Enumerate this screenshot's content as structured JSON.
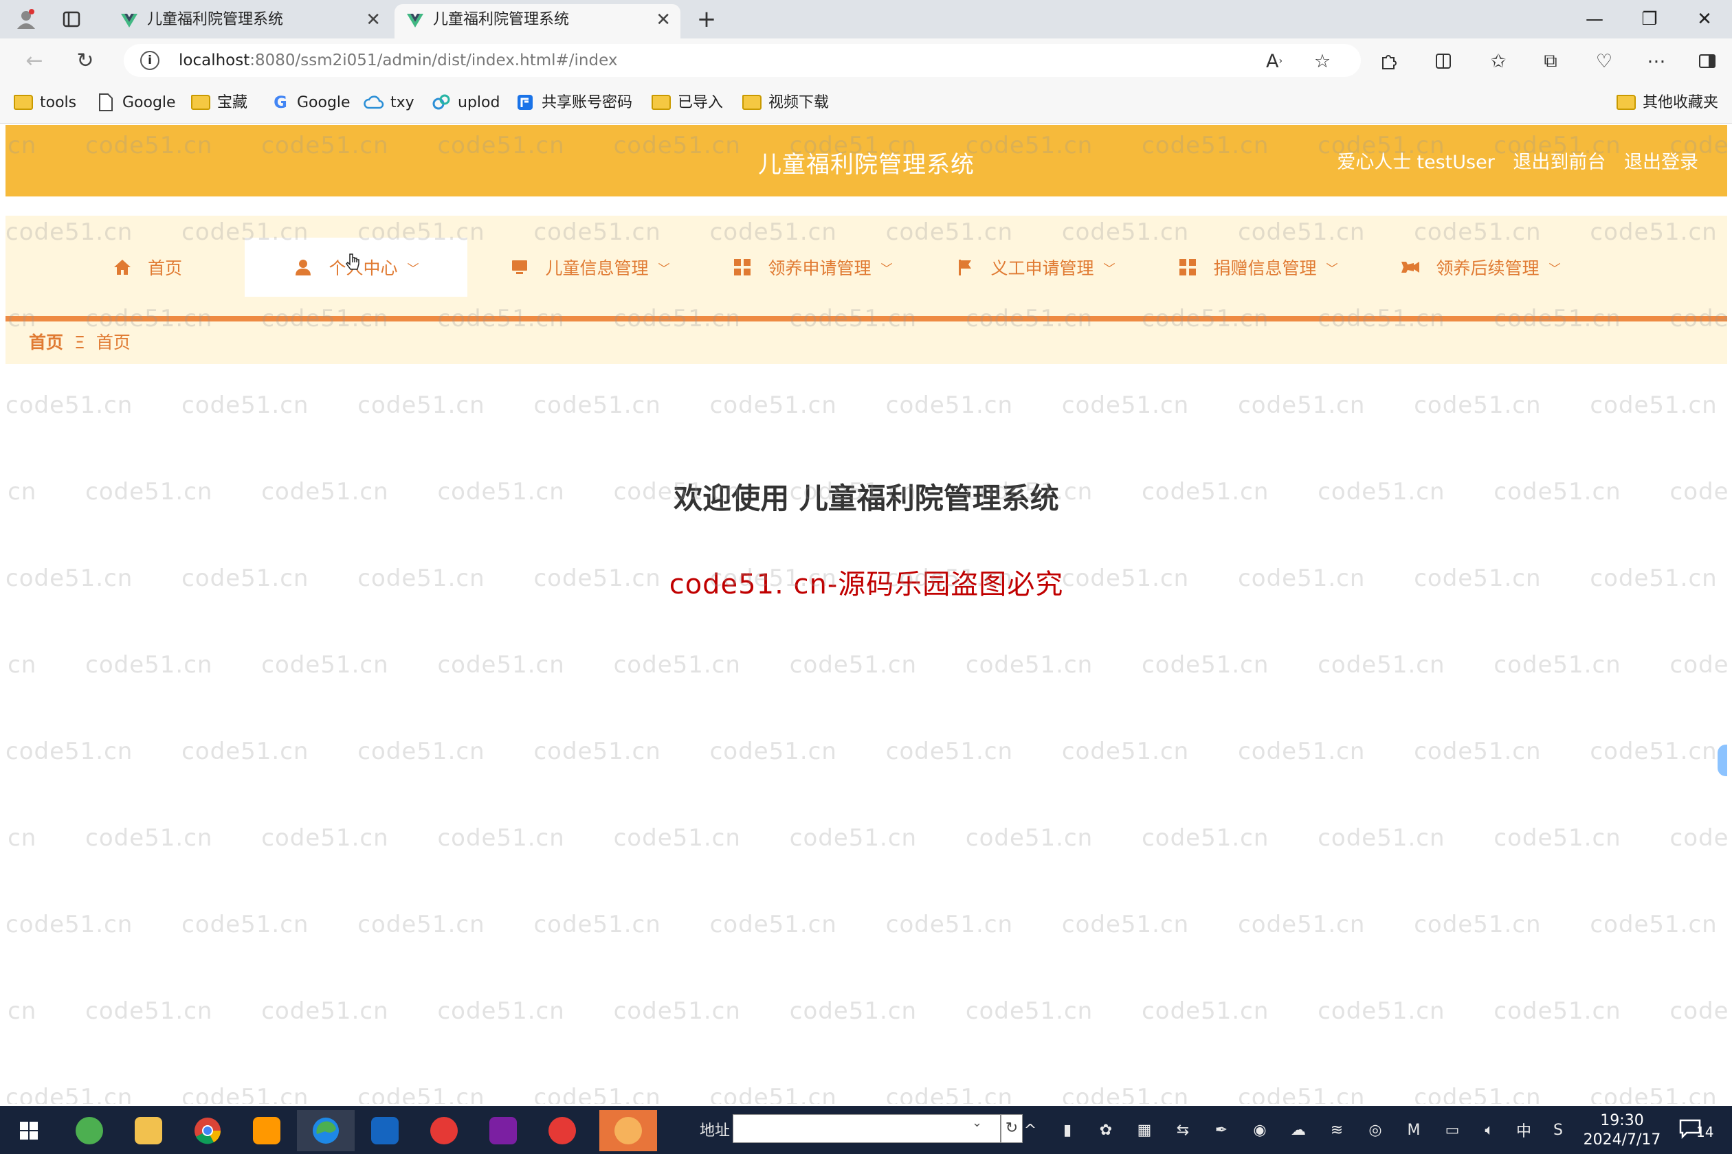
{
  "browser": {
    "tabs": [
      {
        "title": "儿童福利院管理系统",
        "active": false
      },
      {
        "title": "儿童福利院管理系统",
        "active": true
      }
    ],
    "new_tab_icon": "plus-icon",
    "url_host": "localhost",
    "url_rest": ":8080/ssm2i051/admin/dist/index.html#/index",
    "bookmarks": [
      {
        "label": "tools",
        "icon": "folder-icon"
      },
      {
        "label": "Google",
        "icon": "page-icon"
      },
      {
        "label": "宝藏",
        "icon": "folder-icon"
      },
      {
        "label": "Google",
        "icon": "google-icon"
      },
      {
        "label": "txy",
        "icon": "cloud-icon"
      },
      {
        "label": "uplod",
        "icon": "uplod-icon"
      },
      {
        "label": "共享账号密码",
        "icon": "share-icon"
      },
      {
        "label": "已导入",
        "icon": "folder-icon"
      },
      {
        "label": "视频下载",
        "icon": "folder-icon"
      }
    ],
    "other_bookmarks": "其他收藏夹"
  },
  "header": {
    "title": "儿童福利院管理系统",
    "role": "爱心人士",
    "username": "testUser",
    "back_to_front": "退出到前台",
    "logout": "退出登录"
  },
  "nav": {
    "items": [
      {
        "label": "首页",
        "icon": "home-icon",
        "has_dropdown": false,
        "active": false
      },
      {
        "label": "个人中心",
        "icon": "user-icon",
        "has_dropdown": true,
        "active": true
      },
      {
        "label": "儿童信息管理",
        "icon": "monitor-icon",
        "has_dropdown": true,
        "active": false
      },
      {
        "label": "领养申请管理",
        "icon": "grid-icon",
        "has_dropdown": true,
        "active": false
      },
      {
        "label": "义工申请管理",
        "icon": "flag-icon",
        "has_dropdown": true,
        "active": false
      },
      {
        "label": "捐赠信息管理",
        "icon": "grid-icon",
        "has_dropdown": true,
        "active": false
      },
      {
        "label": "领养后续管理",
        "icon": "video-icon",
        "has_dropdown": true,
        "active": false
      }
    ]
  },
  "breadcrumb": {
    "root": "首页",
    "separator": "Ξ",
    "current": "首页"
  },
  "main": {
    "welcome": "欢迎使用 儿童福利院管理系统",
    "notice": "code51. cn-源码乐园盗图必究"
  },
  "watermark": "code51.cn",
  "taskbar": {
    "address_label": "地址",
    "address_value": "",
    "ime": "中",
    "time": "19:30",
    "date": "2024/7/17",
    "notifications": "14"
  },
  "colors": {
    "header_bg": "#f6ba3b",
    "nav_bg": "#fff6dd",
    "accent": "#e07a32",
    "notice_red": "#c00000"
  }
}
